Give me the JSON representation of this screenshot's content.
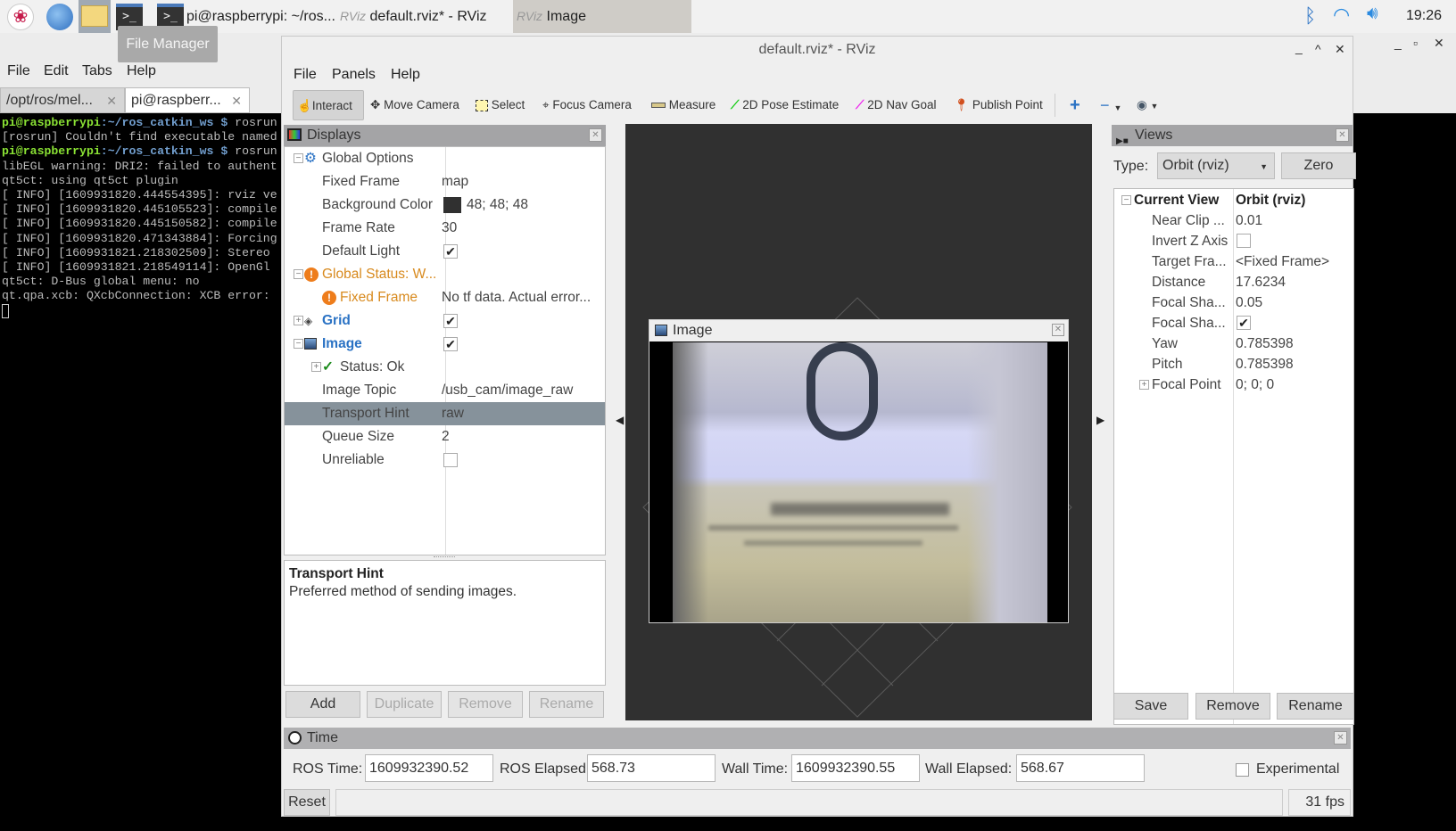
{
  "taskbar": {
    "tasks": [
      {
        "label": "pi@raspberrypi: ~/ros..."
      },
      {
        "label": "default.rviz* - RViz"
      },
      {
        "label": "Image"
      }
    ],
    "clock": "19:26",
    "tooltip": "File Manager",
    "term_icon_glyph": ">_",
    "rviz_logo": "RViz"
  },
  "terminal": {
    "menu": [
      "File",
      "Edit",
      "Tabs",
      "Help"
    ],
    "tabs": [
      {
        "label": "/opt/ros/mel..."
      },
      {
        "label": "pi@raspberr..."
      }
    ],
    "lines": [
      {
        "user": "pi@raspberrypi",
        "path": ":~/ros_catkin_ws $",
        "cmd": " rosrun"
      },
      {
        "text": "[rosrun] Couldn't find executable named"
      },
      {
        "user": "pi@raspberrypi",
        "path": ":~/ros_catkin_ws $",
        "cmd": " rosrun"
      },
      {
        "text": "libEGL warning: DRI2: failed to authent"
      },
      {
        "text": "qt5ct: using qt5ct plugin"
      },
      {
        "text": "[ INFO] [1609931820.444554395]: rviz ve"
      },
      {
        "text": "[ INFO] [1609931820.445105523]: compile"
      },
      {
        "text": "[ INFO] [1609931820.445150582]: compile"
      },
      {
        "text": "[ INFO] [1609931820.471343884]: Forcing"
      },
      {
        "text": "[ INFO] [1609931821.218302509]: Stereo "
      },
      {
        "text": "[ INFO] [1609931821.218549114]: OpenGl "
      },
      {
        "text": "qt5ct: D-Bus global menu: no"
      },
      {
        "text": "qt.qpa.xcb: QXcbConnection: XCB error: "
      }
    ]
  },
  "rviz": {
    "title": "default.rviz* - RViz",
    "menu": [
      "File",
      "Panels",
      "Help"
    ],
    "toolbar": [
      "Interact",
      "Move Camera",
      "Select",
      "Focus Camera",
      "Measure",
      "2D Pose Estimate",
      "2D Nav Goal",
      "Publish Point"
    ],
    "displays": {
      "title": "Displays",
      "rows": [
        {
          "key": "Global Options",
          "value": ""
        },
        {
          "key": "Fixed Frame",
          "value": "map"
        },
        {
          "key": "Background Color",
          "value": "48; 48; 48",
          "swatch": "#303030"
        },
        {
          "key": "Frame Rate",
          "value": "30"
        },
        {
          "key": "Default Light",
          "checked": true
        },
        {
          "key": "Global Status: W...",
          "value": ""
        },
        {
          "key": "Fixed Frame",
          "value": "No tf data.  Actual error..."
        },
        {
          "key": "Grid",
          "checked": true
        },
        {
          "key": "Image",
          "checked": true
        },
        {
          "key": "Status: Ok",
          "value": ""
        },
        {
          "key": "Image Topic",
          "value": "/usb_cam/image_raw"
        },
        {
          "key": "Transport Hint",
          "value": "raw"
        },
        {
          "key": "Queue Size",
          "value": "2"
        },
        {
          "key": "Unreliable",
          "checked": false
        }
      ],
      "desc_title": "Transport Hint",
      "desc_text": "Preferred method of sending images.",
      "buttons": [
        "Add",
        "Duplicate",
        "Remove",
        "Rename"
      ]
    },
    "image_panel": {
      "title": "Image"
    },
    "views": {
      "title": "Views",
      "type_label": "Type:",
      "type_value": "Orbit (rviz)",
      "zero": "Zero",
      "rows": [
        {
          "key": "Current View",
          "value": "Orbit (rviz)"
        },
        {
          "key": "Near Clip ...",
          "value": "0.01"
        },
        {
          "key": "Invert Z Axis",
          "checked": false
        },
        {
          "key": "Target Fra...",
          "value": "<Fixed Frame>"
        },
        {
          "key": "Distance",
          "value": "17.6234"
        },
        {
          "key": "Focal Sha...",
          "value": "0.05"
        },
        {
          "key": "Focal Sha...",
          "checked": true
        },
        {
          "key": "Yaw",
          "value": "0.785398"
        },
        {
          "key": "Pitch",
          "value": "0.785398"
        },
        {
          "key": "Focal Point",
          "value": "0; 0; 0"
        }
      ],
      "buttons": [
        "Save",
        "Remove",
        "Rename"
      ]
    },
    "time": {
      "title": "Time",
      "ros_time_label": "ROS Time:",
      "ros_time": "1609932390.52",
      "ros_elapsed_label": "ROS Elapsed:",
      "ros_elapsed": "568.73",
      "wall_time_label": "Wall Time:",
      "wall_time": "1609932390.55",
      "wall_elapsed_label": "Wall Elapsed:",
      "wall_elapsed": "568.67",
      "experimental": "Experimental",
      "reset": "Reset",
      "fps": "31 fps"
    }
  },
  "colors": {
    "selection": "#86929b",
    "warning": "#d88a1e",
    "link_blue": "#2a72c4",
    "view_bg": "#303030"
  }
}
